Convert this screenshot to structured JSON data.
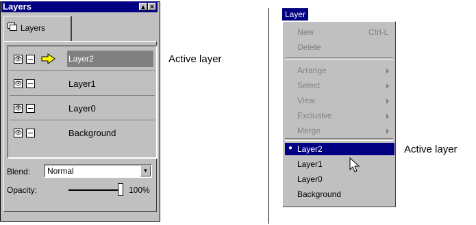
{
  "layers_panel": {
    "title": "Layers",
    "tab_label": "Layers",
    "rows": [
      {
        "name": "Layer2",
        "active": true
      },
      {
        "name": "Layer1",
        "active": false
      },
      {
        "name": "Layer0",
        "active": false
      },
      {
        "name": "Background",
        "active": false
      }
    ],
    "blend_label": "Blend:",
    "blend_value": "Normal",
    "opacity_label": "Opacity:",
    "opacity_value": "100%"
  },
  "annotations": {
    "left": "Active layer",
    "right": "Active layer"
  },
  "layer_menu": {
    "menu_title": "Layer",
    "items": [
      {
        "label": "New",
        "shortcut": "Ctrl-L"
      },
      {
        "label": "Delete"
      },
      {
        "label": "Arrange"
      },
      {
        "label": "Select"
      },
      {
        "label": "View"
      },
      {
        "label": "Exclusive"
      },
      {
        "label": "Merge"
      }
    ],
    "layers": [
      {
        "label": "Layer2",
        "checked": true
      },
      {
        "label": "Layer1"
      },
      {
        "label": "Layer0"
      },
      {
        "label": "Background"
      }
    ]
  },
  "colors": {
    "face": "#c0c0c0",
    "titlebar": "#000080",
    "selection": "#808080",
    "arrow": "#ffff00"
  }
}
